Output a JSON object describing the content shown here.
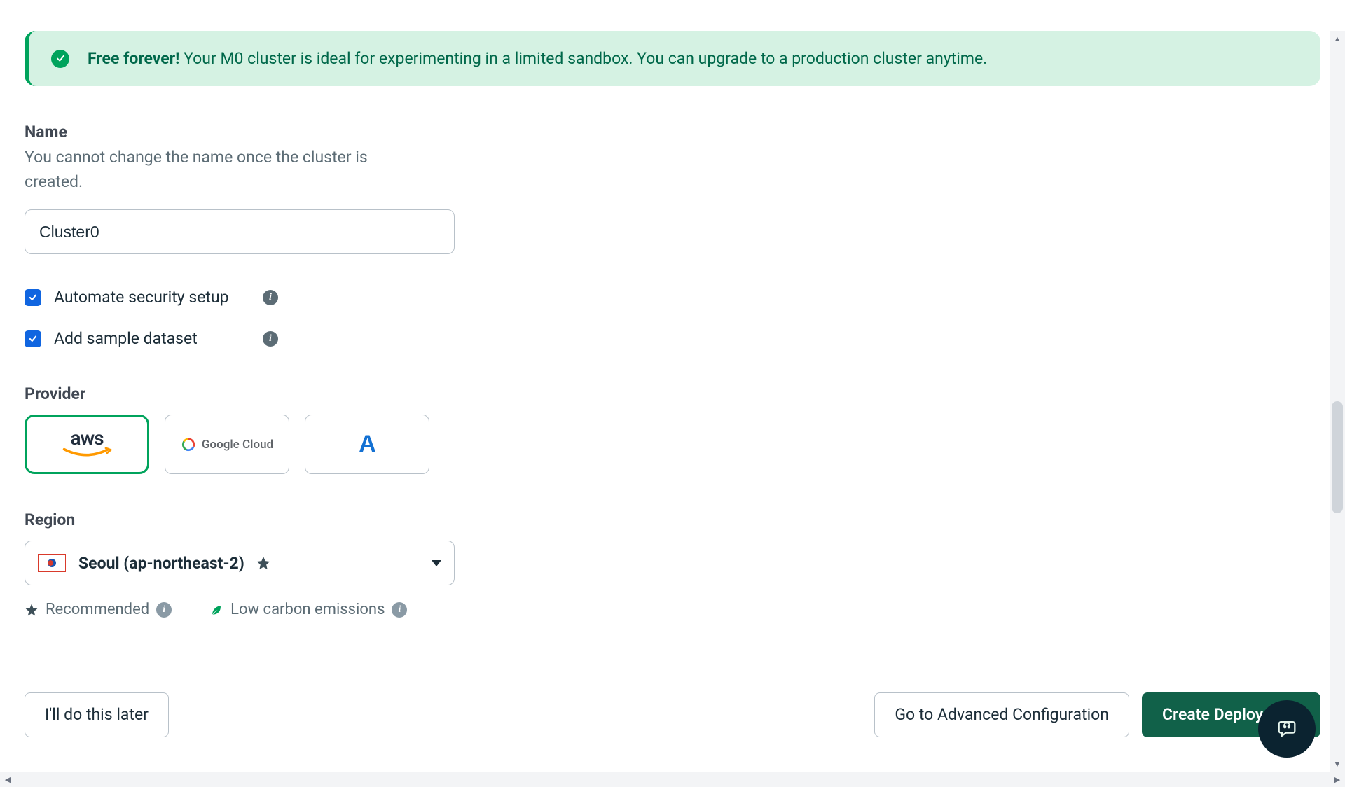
{
  "banner": {
    "bold": "Free forever!",
    "text": " Your M0 cluster is ideal for experimenting in a limited sandbox. You can upgrade to a production cluster anytime."
  },
  "name": {
    "label": "Name",
    "help": "You cannot change the name once the cluster is created.",
    "value": "Cluster0"
  },
  "checkboxes": {
    "security": {
      "label": "Automate security setup",
      "checked": true
    },
    "sample": {
      "label": "Add sample dataset",
      "checked": true
    }
  },
  "provider": {
    "label": "Provider",
    "options": [
      {
        "id": "aws",
        "display": "aws",
        "selected": true
      },
      {
        "id": "gcp",
        "display": "Google Cloud",
        "selected": false
      },
      {
        "id": "azure",
        "display": "A",
        "selected": false
      }
    ]
  },
  "region": {
    "label": "Region",
    "selected": "Seoul (ap-northeast-2)"
  },
  "legend": {
    "recommended": "Recommended",
    "lowcarbon": "Low carbon emissions"
  },
  "footer": {
    "later": "I'll do this later",
    "advanced": "Go to Advanced Configuration",
    "create": "Create Deployment"
  }
}
